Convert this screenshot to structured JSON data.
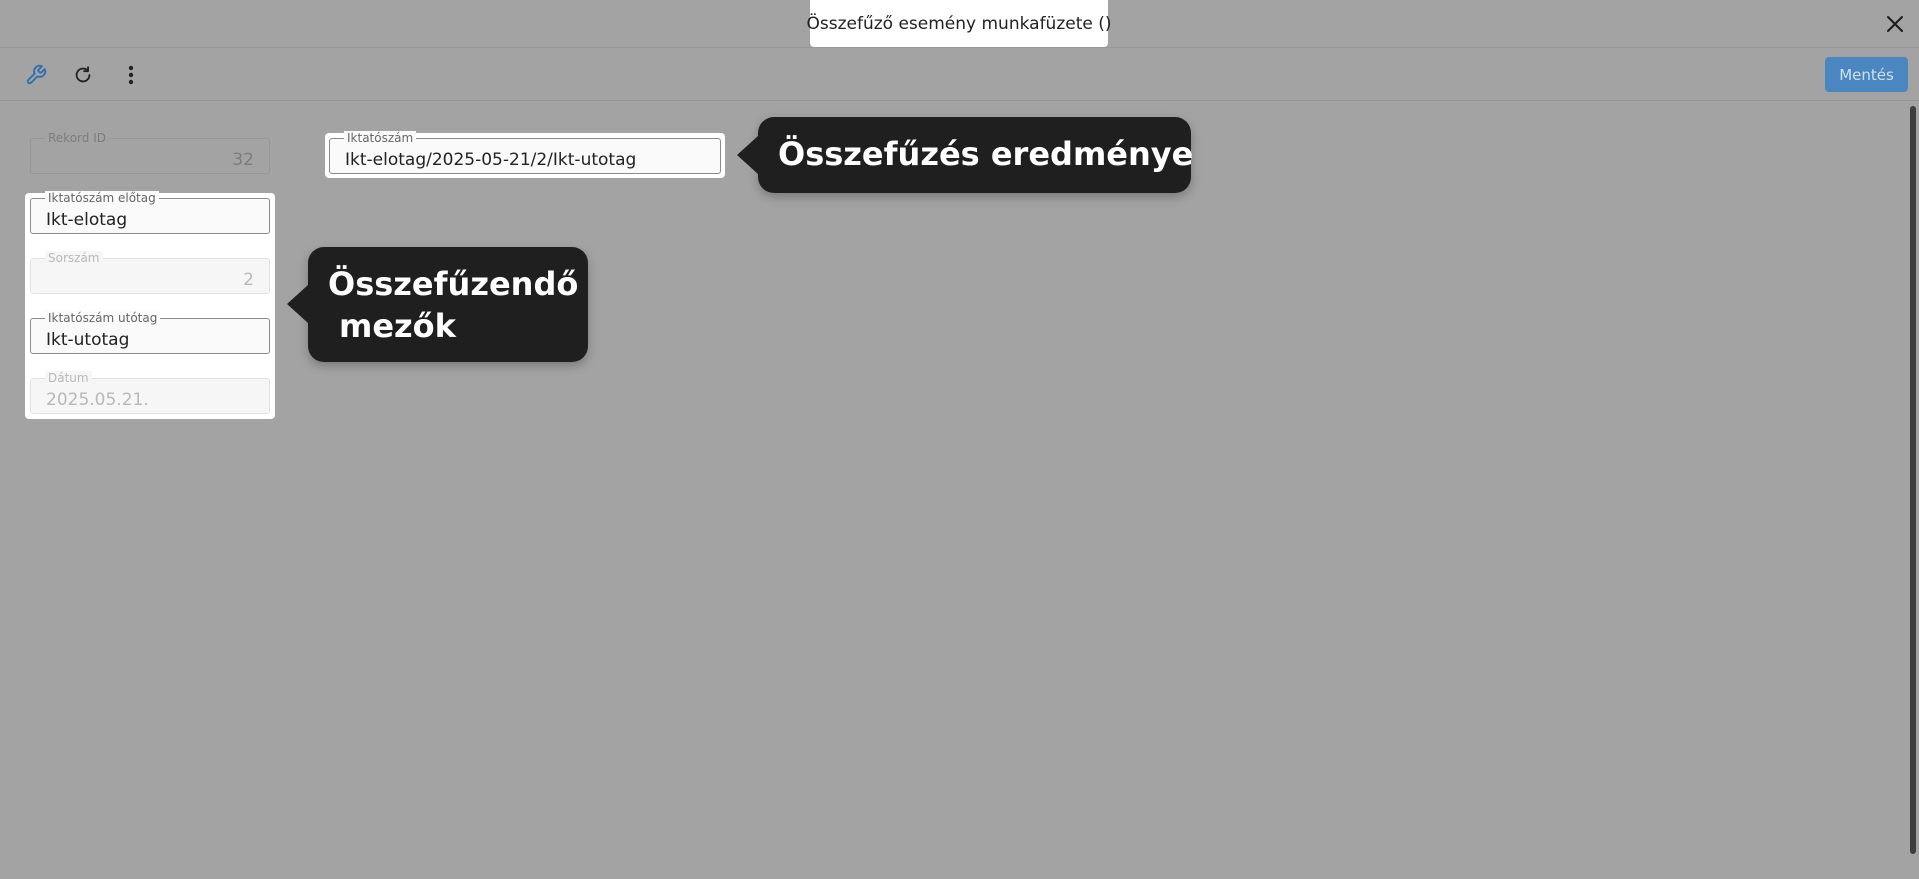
{
  "window": {
    "title": "Összefűző esemény munkafüzete ()"
  },
  "toolbar": {
    "save_label": "Mentés"
  },
  "fields": {
    "record_id": {
      "label": "Rekord ID",
      "value": "32"
    },
    "iktatoszam": {
      "label": "Iktatószám",
      "value": "Ikt-elotag/2025-05-21/2/Ikt-utotag"
    },
    "prefix": {
      "label": "Iktatószám előtag",
      "value": "Ikt-elotag"
    },
    "sorszam": {
      "label": "Sorszám",
      "value": "2"
    },
    "suffix": {
      "label": "Iktatószám utótag",
      "value": "Ikt-utotag"
    },
    "datum": {
      "label": "Dátum",
      "value": "2025.05.21."
    }
  },
  "callouts": {
    "result": "Összefűzés eredménye",
    "fields_line1": "Összefűzendő",
    "fields_line2": "mezők"
  },
  "icons": [
    "wrench-icon",
    "refresh-icon",
    "more-vert-icon",
    "close-icon"
  ],
  "colors": {
    "accent": "#4a86c0",
    "overlay": "#a3a3a3",
    "callout": "#1f1f1f"
  }
}
